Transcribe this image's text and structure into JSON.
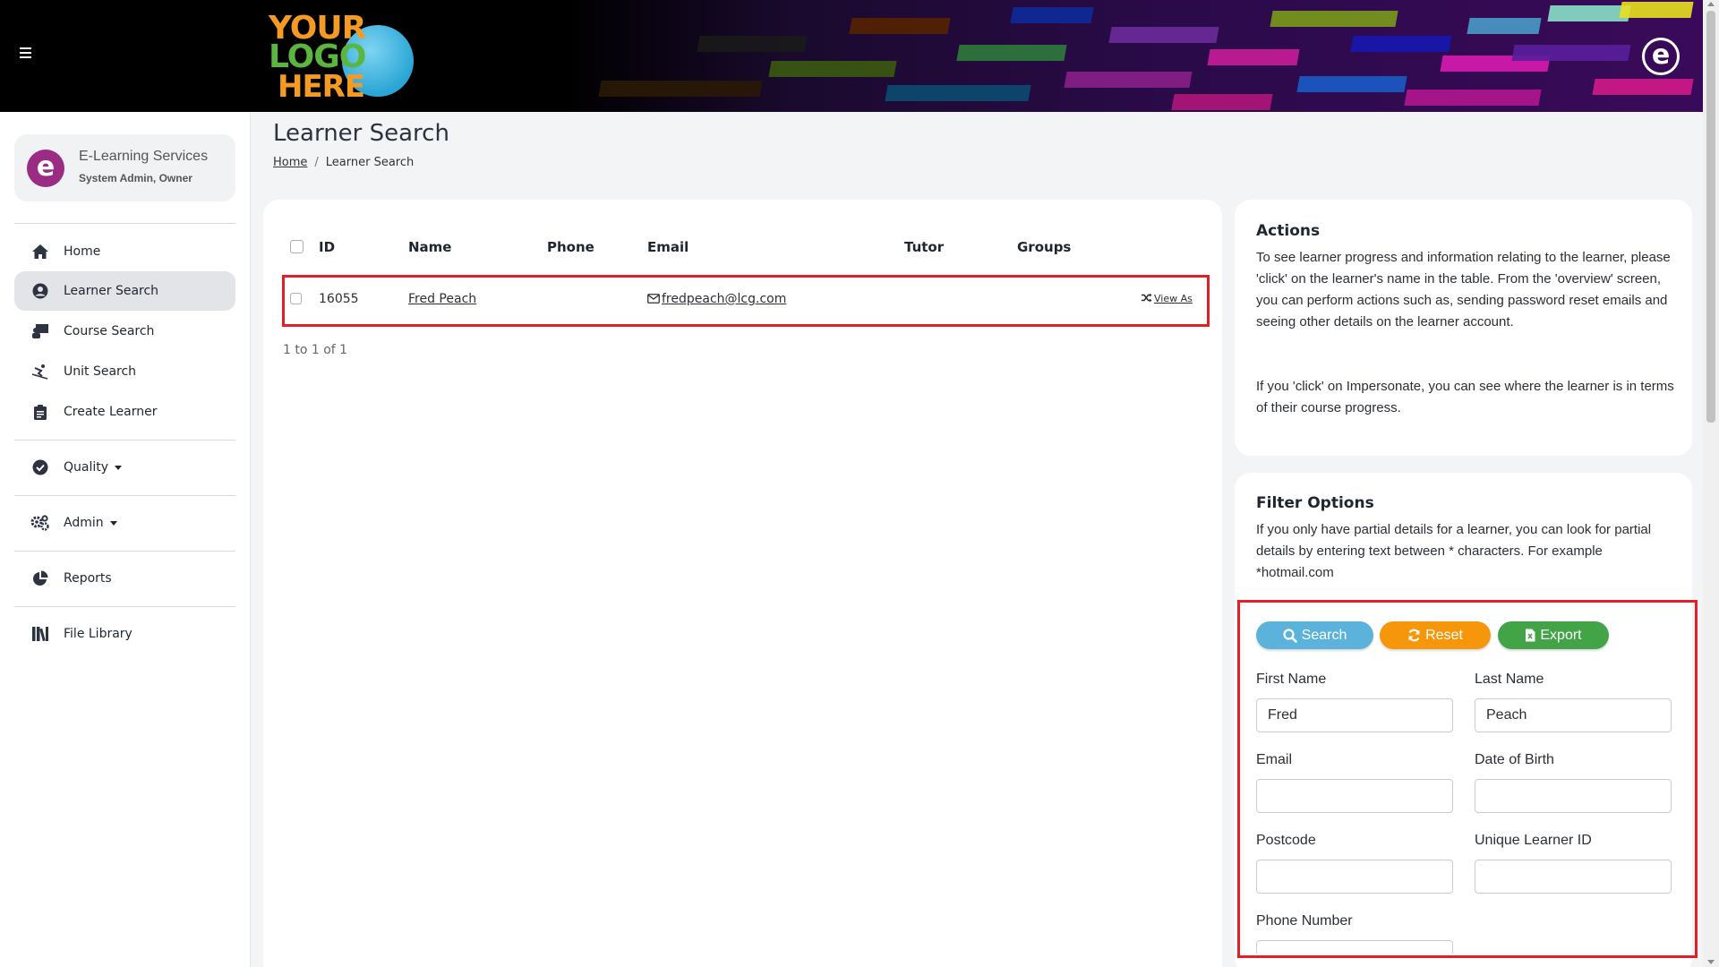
{
  "header": {
    "logo_lines": [
      "YOUR",
      "LOGO",
      "HERE"
    ],
    "brand_mark": "e"
  },
  "sidebar": {
    "user": {
      "logo_letter": "e",
      "org": "E-Learning Services",
      "role": "System Admin, Owner"
    },
    "items": [
      {
        "label": "Home",
        "icon": "home-icon"
      },
      {
        "label": "Learner Search",
        "icon": "user-circle-icon"
      },
      {
        "label": "Course Search",
        "icon": "chalkboard-teacher-icon"
      },
      {
        "label": "Unit Search",
        "icon": "skiing-icon"
      },
      {
        "label": "Create Learner",
        "icon": "clipboard-icon"
      },
      {
        "label": "Quality",
        "icon": "check-circle-icon"
      },
      {
        "label": "Admin",
        "icon": "cogs-icon"
      },
      {
        "label": "Reports",
        "icon": "pie-chart-icon"
      },
      {
        "label": "File Library",
        "icon": "book-shelf-icon"
      }
    ]
  },
  "page": {
    "title": "Learner Search",
    "breadcrumb": {
      "home": "Home",
      "separator": "/",
      "current": "Learner Search"
    }
  },
  "table": {
    "columns": [
      "ID",
      "Name",
      "Phone",
      "Email",
      "Tutor",
      "Groups"
    ],
    "rows": [
      {
        "id": "16055",
        "name": "Fred Peach",
        "phone": "",
        "email": "fredpeach@lcg.com",
        "tutor": "",
        "groups": "",
        "action": "View As"
      }
    ],
    "pagination": "1 to 1 of 1"
  },
  "actions": {
    "title": "Actions",
    "paragraph1": "To see learner progress and information relating to the learner, please 'click' on the learner's name in the table. From the 'overview' screen, you can perform actions such as, sending password reset emails and seeing other details on the learner account.",
    "paragraph2": "If you 'click' on Impersonate, you can see where the learner is in terms of their course progress."
  },
  "filter": {
    "title": "Filter Options",
    "description": "If you only have partial details for a learner, you can look for partial details by entering text between * characters. For example *hotmail.com",
    "buttons": {
      "search": "Search",
      "reset": "Reset",
      "export": "Export"
    },
    "colors": {
      "search": "#5bb3dc",
      "reset": "#f5960b",
      "export": "#43a447",
      "highlight": "#e41e26"
    },
    "fields": {
      "first_name": {
        "label": "First Name",
        "value": "Fred"
      },
      "last_name": {
        "label": "Last Name",
        "value": "Peach"
      },
      "email": {
        "label": "Email",
        "value": ""
      },
      "dob": {
        "label": "Date of Birth",
        "value": ""
      },
      "postcode": {
        "label": "Postcode",
        "value": ""
      },
      "uln": {
        "label": "Unique Learner ID",
        "value": ""
      },
      "phone": {
        "label": "Phone Number",
        "value": ""
      }
    }
  }
}
